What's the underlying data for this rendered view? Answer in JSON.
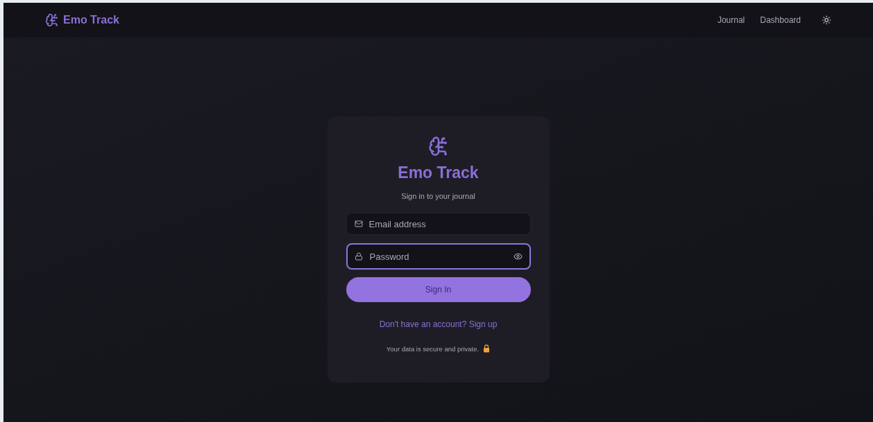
{
  "navbar": {
    "brand": "Emo Track",
    "links": [
      {
        "label": "Journal"
      },
      {
        "label": "Dashboard"
      }
    ]
  },
  "card": {
    "title": "Emo Track",
    "subtitle": "Sign in to your journal",
    "fields": [
      {
        "kind": "email",
        "placeholder": "Email address",
        "focused": false
      },
      {
        "kind": "password",
        "placeholder": "Password",
        "focused": true
      }
    ],
    "button": "Sign In",
    "signup_link": "Don't have an account? Sign up",
    "footer": "Your data is secure and private."
  }
}
